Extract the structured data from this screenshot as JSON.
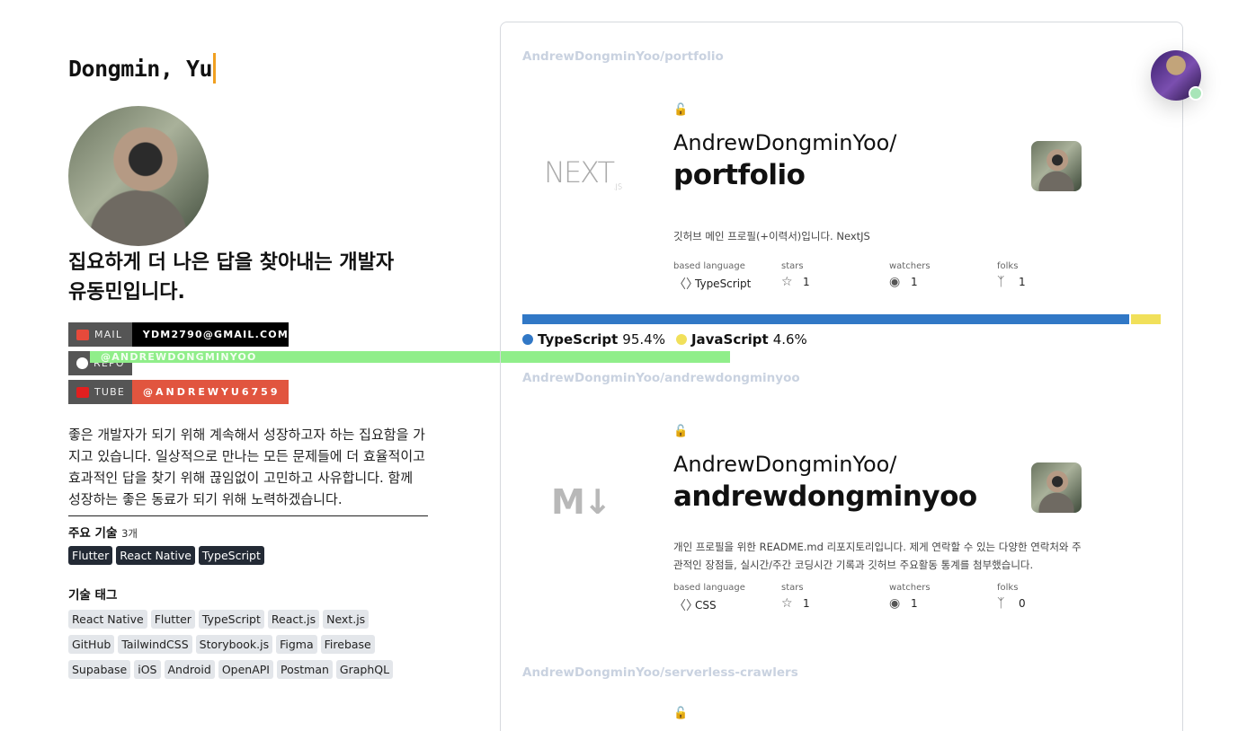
{
  "profile": {
    "name": "Dongmin, Yu",
    "headline_line1": "집요하게 더 나은 답을 찾아내는 개발자",
    "headline_line2": "유동민입니다.",
    "badges": [
      {
        "label": "MAIL",
        "value": "YDM2790@GMAIL.COM",
        "icon": "gmail-icon",
        "color": "#000000"
      },
      {
        "label": "REPO",
        "value": "@ANDREWDONGMINYOO",
        "icon": "github-icon",
        "color": "#90ee8a"
      },
      {
        "label": "TUBE",
        "value": "@ANDREWYU6759",
        "icon": "youtube-icon",
        "color": "#e1553f"
      }
    ],
    "intro": "좋은 개발자가 되기 위해 계속해서 성장하고자 하는 집요함을 가지고 있습니다. 일상적으로 만나는 모든 문제들에 더 효율적이고 효과적인 답을 찾기 위해 끊임없이 고민하고 사유합니다. 함께 성장하는 좋은 동료가 되기 위해 노력하겠습니다.",
    "main_skills_title": "주요 기술",
    "main_skills_count": "3개",
    "main_skills": [
      "Flutter",
      "React Native",
      "TypeScript"
    ],
    "tags_title": "기술 태그",
    "tags": [
      "React Native",
      "Flutter",
      "TypeScript",
      "React.js",
      "Next.js",
      "GitHub",
      "TailwindCSS",
      "Storybook.js",
      "Figma",
      "Firebase",
      "Supabase",
      "iOS",
      "Android",
      "OpenAPI",
      "Postman",
      "GraphQL"
    ]
  },
  "repos": [
    {
      "path": "AndrewDongminYoo/portfolio",
      "owner": "AndrewDongminYoo/",
      "name": "portfolio",
      "logo": "nextjs-logo",
      "logo_text": "NEXT",
      "logo_sub": ".JS",
      "description": "깃허브 메인 프로필(+이력서)입니다. NextJS",
      "labels": {
        "language": "based language",
        "stars": "stars",
        "watchers": "watchers",
        "folks": "folks"
      },
      "language": "TypeScript",
      "stars": "1",
      "watchers": "1",
      "folks": "1",
      "languages": [
        {
          "name": "TypeScript",
          "percent": "95.4%",
          "value": 95.4,
          "color": "#3178c6"
        },
        {
          "name": "JavaScript",
          "percent": "4.6%",
          "value": 4.6,
          "color": "#f1e05a"
        }
      ]
    },
    {
      "path": "AndrewDongminYoo/andrewdongminyoo",
      "owner": "AndrewDongminYoo/",
      "name": "andrewdongminyoo",
      "logo": "markdown-logo",
      "logo_text": "M↓",
      "description": "개인 프로필을 위한 README.md 리포지토리입니다. 제게 연락할 수 있는 다양한 연락처와 주관적인 장점들, 실시간/주간 코딩시간 기록과 깃허브 주요활동 통계를 첨부했습니다.",
      "labels": {
        "language": "based language",
        "stars": "stars",
        "watchers": "watchers",
        "folks": "folks"
      },
      "language": "CSS",
      "stars": "1",
      "watchers": "1",
      "folks": "0"
    },
    {
      "path": "AndrewDongminYoo/serverless-crawlers"
    }
  ]
}
